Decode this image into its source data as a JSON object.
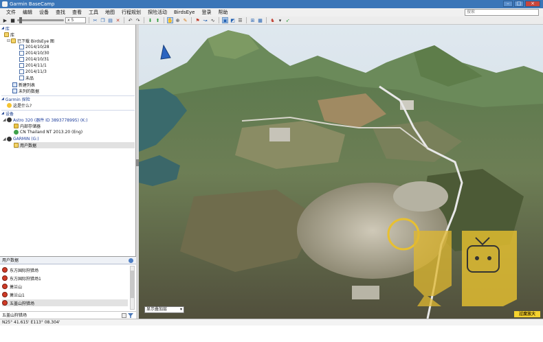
{
  "window": {
    "title": "Garmin BaseCamp",
    "min_label": "–",
    "max_label": "□",
    "close_label": "×"
  },
  "menu": {
    "items": [
      "文件",
      "编辑",
      "设备",
      "查找",
      "查看",
      "工具",
      "地图",
      "行程规划",
      "探险活动",
      "BirdsEye",
      "登录",
      "帮助"
    ]
  },
  "search": {
    "placeholder": "搜索"
  },
  "toolbar": {
    "speed_label": "x 5"
  },
  "library": {
    "header": "库",
    "root_label": "库",
    "downloaded_label": "已下载 BirdsEye 图",
    "dates": [
      "2014/10/28",
      "2014/10/30",
      "2014/10/31",
      "2014/11/1",
      "2014/11/3"
    ],
    "unlisted_label": "未品",
    "new_list_label": "新建列表",
    "unlisted_data_label": "未列的数据"
  },
  "garmin_adventures": {
    "header": "Garmin 探险",
    "item_label": "这是什么?"
  },
  "devices": {
    "header": "设备",
    "device1_label": "Astro 320 (器件 ID 3893778995) (K:)",
    "internal_storage_label": "内部存储器",
    "map_label": "CN Thailand NT 2013.20 (Eng)",
    "device2_label": "GARMIN (G:)",
    "user_data_label": "用户数据"
  },
  "user_data_panel": {
    "header": "用户数据",
    "items": [
      "东方国际狩猎场",
      "东方国际狩猎场1",
      "萧兰山",
      "萧兰山1",
      "五盖山狩猎场"
    ],
    "footer_value": "五盖山狩猎场"
  },
  "map": {
    "overlay_select_value": "显示叠加层",
    "watermark_text": "过度放大"
  },
  "status": {
    "coordinates": "N25° 41.615' E113° 08.304'"
  },
  "colors": {
    "title_bar": "#3b76b8",
    "highlight_yellow": "#f6d32e",
    "header_blue": "#1b3f8f"
  }
}
